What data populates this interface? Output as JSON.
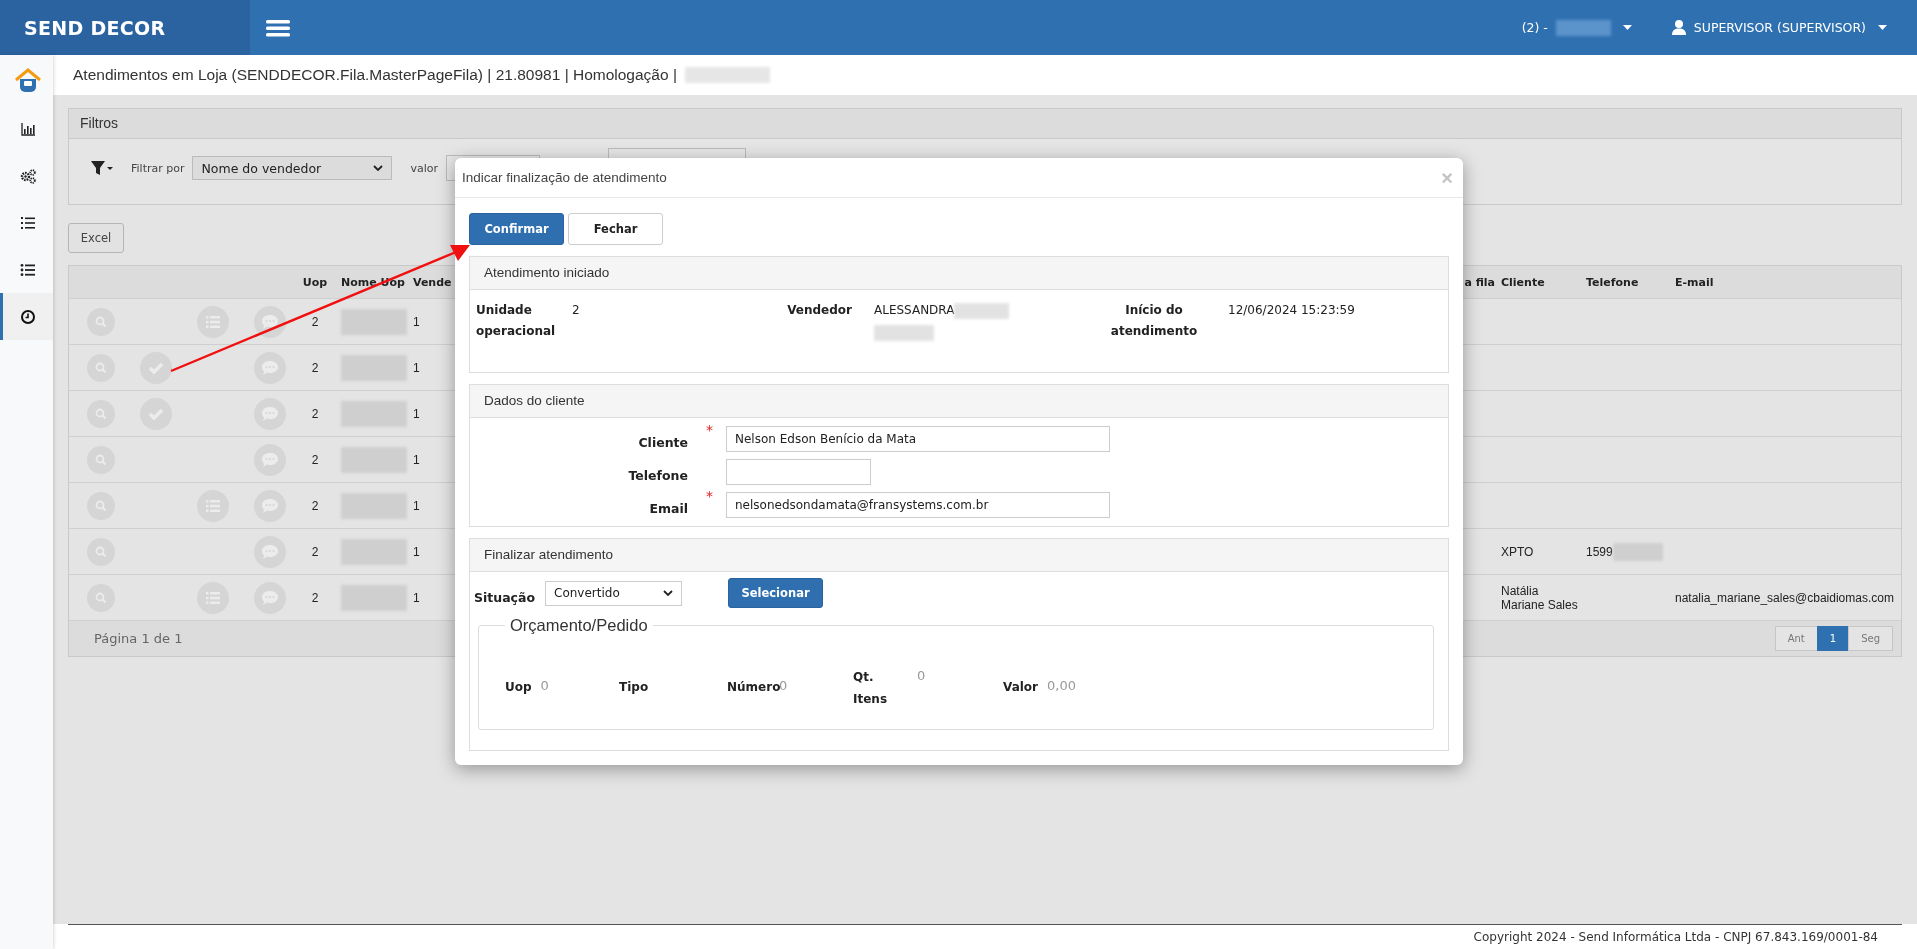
{
  "header": {
    "brand": "SEND DECOR",
    "unit_label": "(2) -",
    "unit_redacted": true,
    "user": "SUPERVISOR (SUPERVISOR)"
  },
  "sidebar": {
    "items": [
      {
        "kind": "logo",
        "selected": false
      },
      {
        "kind": "chart",
        "selected": false
      },
      {
        "kind": "gears",
        "selected": false
      },
      {
        "kind": "numbered-list",
        "selected": false
      },
      {
        "kind": "list",
        "selected": false
      },
      {
        "kind": "clock",
        "selected": true
      }
    ]
  },
  "page_title": {
    "text": "Atendimentos em Loja (SENDDECOR.Fila.MasterPageFila) | 21.80981 | Homologação |",
    "redacted": true
  },
  "filters": {
    "title": "Filtros",
    "filter_label": "Filtrar por",
    "filter_value": "Nome do vendedor",
    "value_label": "valor"
  },
  "excel_button": "Excel",
  "table": {
    "columns": [
      "Uop",
      "Nome Uop",
      "Vende",
      "a fila",
      "Cliente",
      "Telefone",
      "E-mail"
    ],
    "rows": [
      {
        "actions": [
          {
            "kind": "search"
          },
          {
            "kind": "list"
          },
          {
            "kind": "chat"
          }
        ],
        "uop": "2",
        "nome_uop_redacted": true,
        "column_3": "1"
      },
      {
        "actions": [
          {
            "kind": "search"
          },
          {
            "kind": "check"
          },
          {
            "kind": "chat"
          }
        ],
        "uop": "2",
        "nome_uop_redacted": true,
        "column_3": "1"
      },
      {
        "actions": [
          {
            "kind": "search"
          },
          {
            "kind": "check"
          },
          {
            "kind": "chat"
          }
        ],
        "uop": "2",
        "nome_uop_redacted": true,
        "column_3": "1"
      },
      {
        "actions": [
          {
            "kind": "search"
          },
          {
            "kind": "chat"
          }
        ],
        "uop": "2",
        "nome_uop_redacted": true,
        "column_3": "1"
      },
      {
        "actions": [
          {
            "kind": "search"
          },
          {
            "kind": "list"
          },
          {
            "kind": "chat"
          }
        ],
        "uop": "2",
        "nome_uop_redacted": true,
        "column_3": "1"
      },
      {
        "actions": [
          {
            "kind": "search"
          },
          {
            "kind": "chat"
          }
        ],
        "uop": "2",
        "nome_uop_redacted": true,
        "column_3": "1",
        "cliente": "XPTO",
        "telefone": "1599",
        "telefone_redacted": true
      },
      {
        "actions": [
          {
            "kind": "search"
          },
          {
            "kind": "list"
          },
          {
            "kind": "chat"
          }
        ],
        "uop": "2",
        "nome_uop_redacted": true,
        "column_3": "1",
        "cliente": "Natália Mariane Sales",
        "email": "natalia_mariane_sales@cbaidiomas.com"
      }
    ]
  },
  "pagination": {
    "summary": "Página 1 de 1",
    "pages": [
      {
        "label": "Ant",
        "selected": false
      },
      {
        "label": "1",
        "selected": true
      },
      {
        "label": "Seg",
        "selected": false
      }
    ]
  },
  "footer": "Copyright 2024 - Send Informática Ltda - CNPJ 67.843.169/0001-84",
  "modal": {
    "title": "Indicar finalização de atendimento",
    "close": "×",
    "buttons": [
      {
        "label": "Confirmar",
        "kind": "primary"
      },
      {
        "label": "Fechar",
        "kind": "default"
      }
    ],
    "started": {
      "title": "Atendimento iniciado",
      "fields": [
        {
          "label": "Unidade operacional",
          "value": "2",
          "redacted": false
        },
        {
          "label": "Vendedor",
          "value": "ALESSANDRA",
          "redacted": true
        },
        {
          "label": "Início do atendimento",
          "value": "12/06/2024 15:23:59",
          "redacted": false
        }
      ]
    },
    "client": {
      "title": "Dados do cliente",
      "fields": [
        {
          "label": "Cliente",
          "required_mark": "*",
          "value": "Nelson Edson Benício da Mata",
          "kind": "wide"
        },
        {
          "label": "Telefone",
          "kind": "narrow"
        },
        {
          "label": "Email",
          "required_mark": "*",
          "value": "nelsonedsondamata@fransystems.com.br",
          "kind": "wide"
        }
      ]
    },
    "finish": {
      "title": "Finalizar atendimento",
      "status_label": "Situação",
      "status_value": "Convertido",
      "select_button": "Selecionar",
      "order": {
        "legend": "Orçamento/Pedido",
        "fields": [
          {
            "label": "Uop",
            "value": "0"
          },
          {
            "label": "Tipo"
          },
          {
            "label": "Número",
            "value": "0"
          },
          {
            "label": "Qt. Itens",
            "value": "0"
          },
          {
            "label": "Valor",
            "value": "0,00"
          }
        ]
      }
    }
  }
}
